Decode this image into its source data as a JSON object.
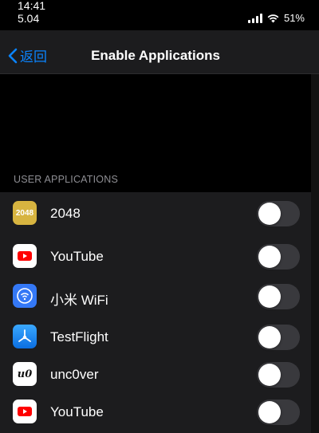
{
  "status_bar": {
    "time": "14:41",
    "date": "5.04",
    "battery": "51%"
  },
  "nav": {
    "back_label": "返回",
    "title": "Enable Applications"
  },
  "section": {
    "header": "USER APPLICATIONS"
  },
  "apps": [
    {
      "name": "2048",
      "icon": "2048-app-icon",
      "icon_text": "2048",
      "enabled": false
    },
    {
      "name": "YouTube",
      "icon": "youtube-icon",
      "enabled": false
    },
    {
      "name": "小米 WiFi",
      "icon": "mi-wifi-icon",
      "enabled": false
    },
    {
      "name": "TestFlight",
      "icon": "testflight-icon",
      "enabled": false
    },
    {
      "name": "unc0ver",
      "icon": "unc0ver-icon",
      "icon_text": "u0",
      "enabled": false
    },
    {
      "name": "YouTube",
      "icon": "youtube-icon",
      "enabled": false
    }
  ],
  "colors": {
    "accent": "#0a84ff",
    "toggle_off": "#39393d",
    "list_bg": "#1c1c1e",
    "icon_2048": "#d7b440",
    "youtube_red": "#ff0000"
  }
}
